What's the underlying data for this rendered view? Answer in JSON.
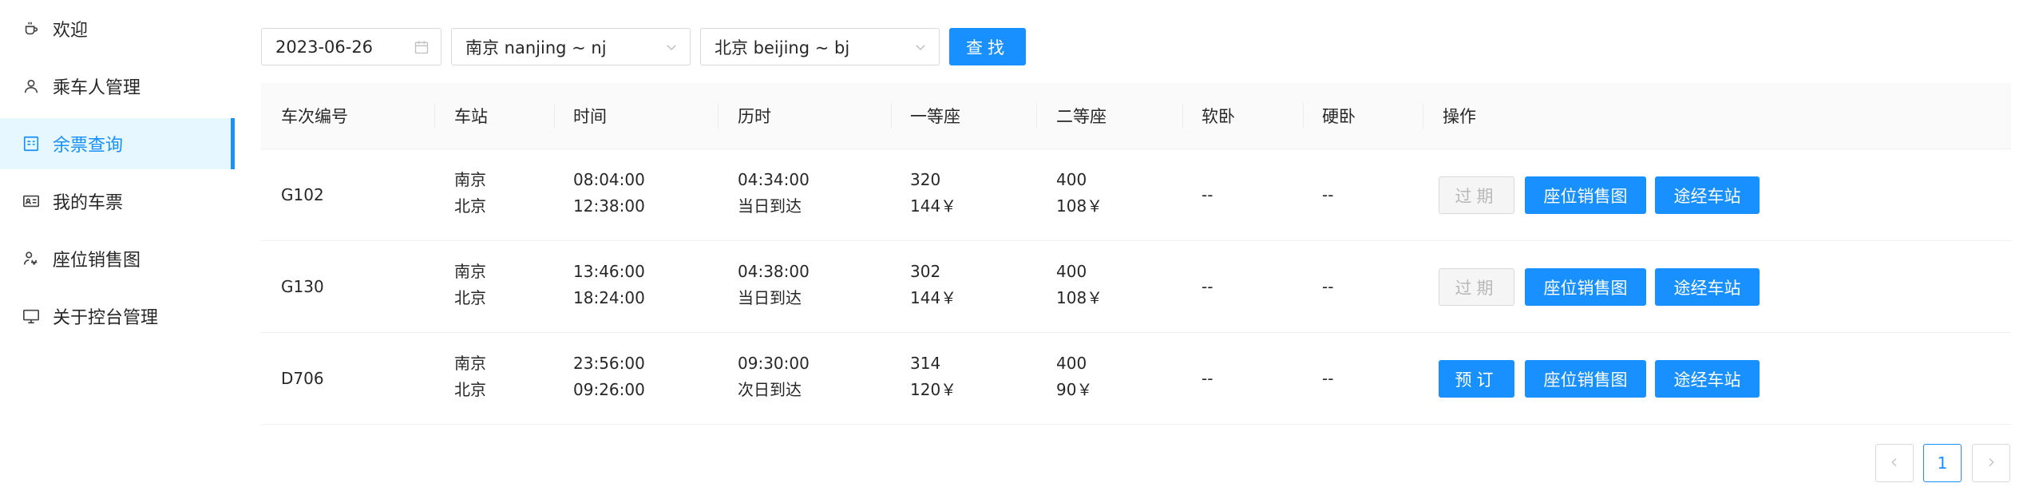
{
  "sidebar": {
    "items": [
      {
        "label": "欢迎",
        "icon": "coffee-icon"
      },
      {
        "label": "乘车人管理",
        "icon": "user-icon"
      },
      {
        "label": "余票查询",
        "icon": "ticket-search-icon",
        "active": true
      },
      {
        "label": "我的车票",
        "icon": "id-card-icon"
      },
      {
        "label": "座位销售图",
        "icon": "seat-chart-icon"
      },
      {
        "label": "关于控台管理",
        "icon": "desktop-icon"
      }
    ]
  },
  "search": {
    "date": "2023-06-26",
    "from": "南京 nanjing ~ nj",
    "to": "北京 beijing ~ bj",
    "button": "查找"
  },
  "table": {
    "headers": [
      "车次编号",
      "车站",
      "时间",
      "历时",
      "一等座",
      "二等座",
      "软卧",
      "硬卧",
      "操作"
    ],
    "rows": [
      {
        "train": "G102",
        "from_station": "南京",
        "to_station": "北京",
        "depart": "08:04:00",
        "arrive": "12:38:00",
        "duration": "04:34:00",
        "arrival_day": "当日到达",
        "first_count": "320",
        "first_price": "144￥",
        "second_count": "400",
        "second_price": "108￥",
        "soft": "--",
        "hard": "--",
        "action": "过期",
        "action_state": "disabled",
        "seat_map": "座位销售图",
        "stops": "途经车站"
      },
      {
        "train": "G130",
        "from_station": "南京",
        "to_station": "北京",
        "depart": "13:46:00",
        "arrive": "18:24:00",
        "duration": "04:38:00",
        "arrival_day": "当日到达",
        "first_count": "302",
        "first_price": "144￥",
        "second_count": "400",
        "second_price": "108￥",
        "soft": "--",
        "hard": "--",
        "action": "过期",
        "action_state": "disabled",
        "seat_map": "座位销售图",
        "stops": "途经车站"
      },
      {
        "train": "D706",
        "from_station": "南京",
        "to_station": "北京",
        "depart": "23:56:00",
        "arrive": "09:26:00",
        "duration": "09:30:00",
        "arrival_day": "次日到达",
        "first_count": "314",
        "first_price": "120￥",
        "second_count": "400",
        "second_price": "90￥",
        "soft": "--",
        "hard": "--",
        "action": "预订",
        "action_state": "enabled",
        "seat_map": "座位销售图",
        "stops": "途经车站"
      }
    ]
  },
  "pagination": {
    "current": "1"
  },
  "colors": {
    "primary": "#1890ff",
    "active_bg": "#e6f7ff",
    "header_bg": "#fafafa"
  }
}
